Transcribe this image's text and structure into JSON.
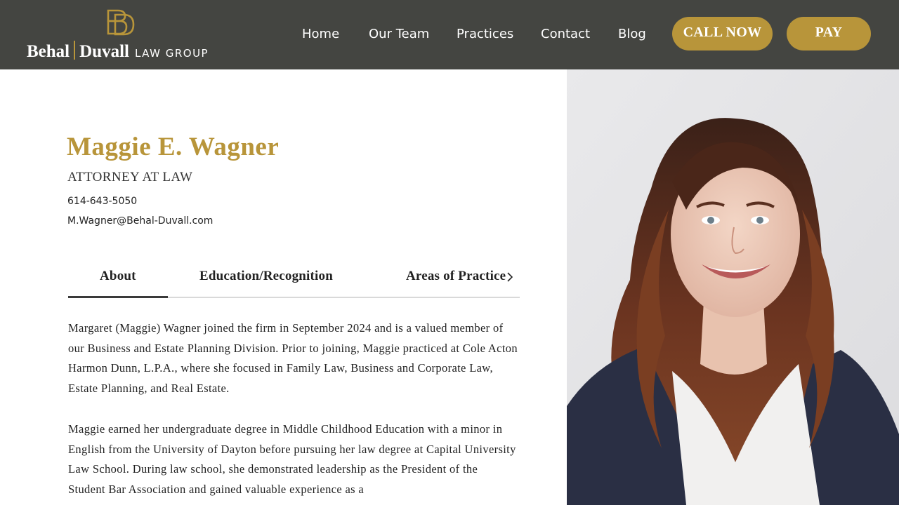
{
  "brand": {
    "name_part1": "Behal",
    "name_part2": "Duvall",
    "name_part3": "LAW GROUP",
    "accent_color": "#b8953a",
    "header_color": "#444541"
  },
  "nav": {
    "items": [
      {
        "label": "Home"
      },
      {
        "label": "Our Team"
      },
      {
        "label": "Practices"
      },
      {
        "label": "Contact"
      },
      {
        "label": "Blog"
      }
    ],
    "call_label": "CALL NOW",
    "pay_label": "PAY"
  },
  "profile": {
    "name": "Maggie E. Wagner",
    "title": "ATTORNEY AT LAW",
    "phone": "614-643-5050",
    "email": "M.Wagner@Behal-Duvall.com"
  },
  "tabs": {
    "items": [
      {
        "label": "About"
      },
      {
        "label": "Education/Recognition"
      },
      {
        "label": "Areas of Practice"
      }
    ],
    "active": "About",
    "next_icon": "chevron-right-icon"
  },
  "about": {
    "paragraphs": [
      "Margaret (Maggie) Wagner joined the firm in September 2024 and is a valued member of our Business and Estate Planning Division. Prior to joining, Maggie practiced at Cole Acton Harmon Dunn, L.P.A., where she focused in Family Law, Business and Corporate Law, Estate Planning, and Real Estate.",
      "Maggie earned her undergraduate degree in Middle Childhood Education with a minor in English from the University of Dayton before pursuing her law degree at Capital University Law School. During law school, she demonstrated leadership as the President of the Student Bar Association and gained valuable experience as a"
    ]
  }
}
